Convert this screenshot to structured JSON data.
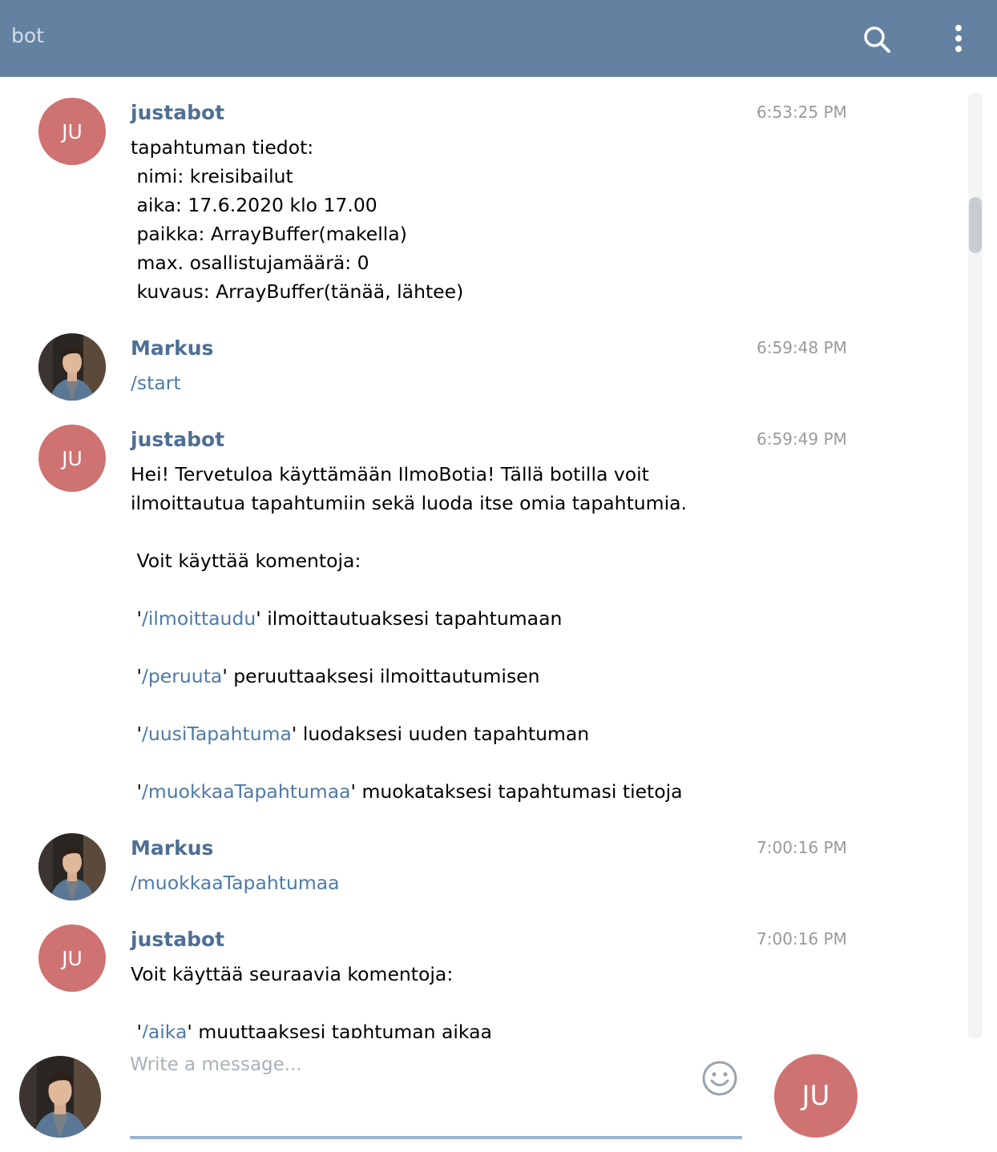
{
  "header": {
    "title": "bot",
    "search_icon": "search-icon",
    "menu_icon": "vertical-dots-menu-icon"
  },
  "colors": {
    "header_bg": "#6381a0",
    "bot_avatar_bg": "#cf7272",
    "author_name": "#4e6f94",
    "command_link": "#4e7aa5"
  },
  "messages": [
    {
      "author": "justabot",
      "avatar_initials": "JU",
      "time": "6:53:25 PM",
      "lines": [
        "tapahtuman tiedot:",
        " nimi: kreisibailut",
        " aika: 17.6.2020 klo 17.00",
        " paikka: ArrayBuffer(makella)",
        " max. osallistujamäärä: 0",
        " kuvaus: ArrayBuffer(tänää, lähtee)"
      ]
    },
    {
      "author": "Markus",
      "time": "6:59:48 PM",
      "text": "/start"
    },
    {
      "author": "justabot",
      "avatar_initials": "JU",
      "time": "6:59:49 PM",
      "intro_line1": "Hei! Tervetuloa käyttämään IlmoBotia! Tällä botilla voit",
      "intro_line2": "ilmoittautua tapahtumiin sekä luoda itse omia tapahtumia.",
      "commands_intro": " Voit käyttää komentoja:",
      "commands": [
        {
          "cmd": "/ilmoittaudu",
          "desc": "' ilmoittautuaksesi tapahtumaan"
        },
        {
          "cmd": "/peruuta",
          "desc": "' peruuttaaksesi ilmoittautumisen"
        },
        {
          "cmd": "/uusiTapahtuma",
          "desc": "' luodaksesi uuden tapahtuman"
        },
        {
          "cmd": "/muokkaaTapahtumaa",
          "desc": "' muokataksesi tapahtumasi tietoja"
        }
      ]
    },
    {
      "author": "Markus",
      "time": "7:00:16 PM",
      "text": "/muokkaaTapahtumaa"
    },
    {
      "author": "justabot",
      "avatar_initials": "JU",
      "time": "7:00:16 PM",
      "line1": "Voit käyttää seuraavia komentoja:",
      "partial_cmd": "/aika",
      "partial_desc": "' muuttaaksesi taphtuman aikaa"
    }
  ],
  "composer": {
    "placeholder": "Write a message...",
    "emoji_icon": "smiley-emoji-icon",
    "send_avatar_initials": "JU"
  }
}
